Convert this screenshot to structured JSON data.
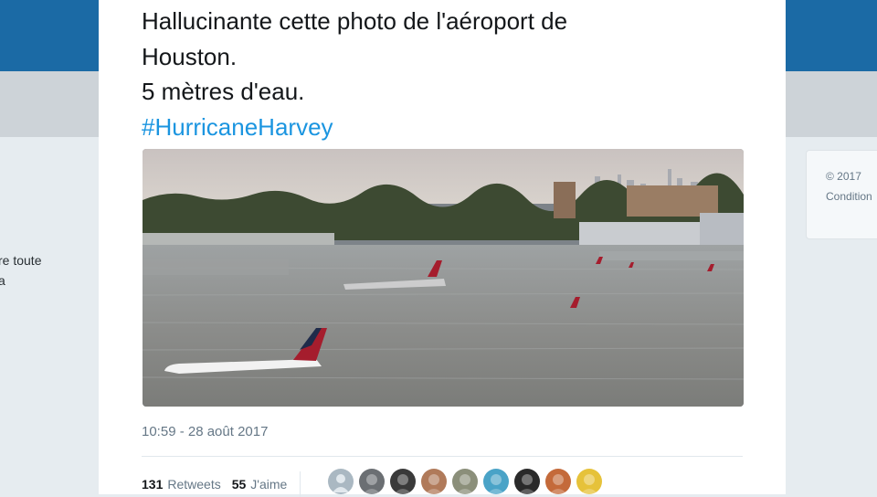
{
  "sidebar_left": {
    "line1": "re toute",
    "line2": "a"
  },
  "sidebar_right": {
    "line1": "© 2017",
    "line2": "Condition"
  },
  "tweet": {
    "text_line1": "Hallucinante cette photo de l'aéroport de",
    "text_line2": "Houston.",
    "text_line3": "5 mètres d'eau.",
    "hashtag": "#HurricaneHarvey",
    "hashtag_color": "#1b95e0",
    "timestamp": "10:59 - 28 août 2017",
    "retweets_count": "131",
    "retweets_label": "Retweets",
    "likes_count": "55",
    "likes_label": "J'aime"
  },
  "likers": [
    {
      "icon": "default-avatar-icon",
      "color": "#aab8c2"
    },
    {
      "icon": "avatar-icon",
      "color": "#6b6f73"
    },
    {
      "icon": "avatar-icon",
      "color": "#3a3a3a"
    },
    {
      "icon": "avatar-icon",
      "color": "#b07a5a"
    },
    {
      "icon": "avatar-icon",
      "color": "#8b8f7a"
    },
    {
      "icon": "avatar-icon",
      "color": "#4aa3c7"
    },
    {
      "icon": "avatar-icon",
      "color": "#2a2a2a"
    },
    {
      "icon": "avatar-icon",
      "color": "#c46a3a"
    },
    {
      "icon": "avatar-icon",
      "color": "#e6c23a"
    }
  ],
  "colors": {
    "topbar": "#1b6aa5",
    "background": "#e6ecf0"
  }
}
